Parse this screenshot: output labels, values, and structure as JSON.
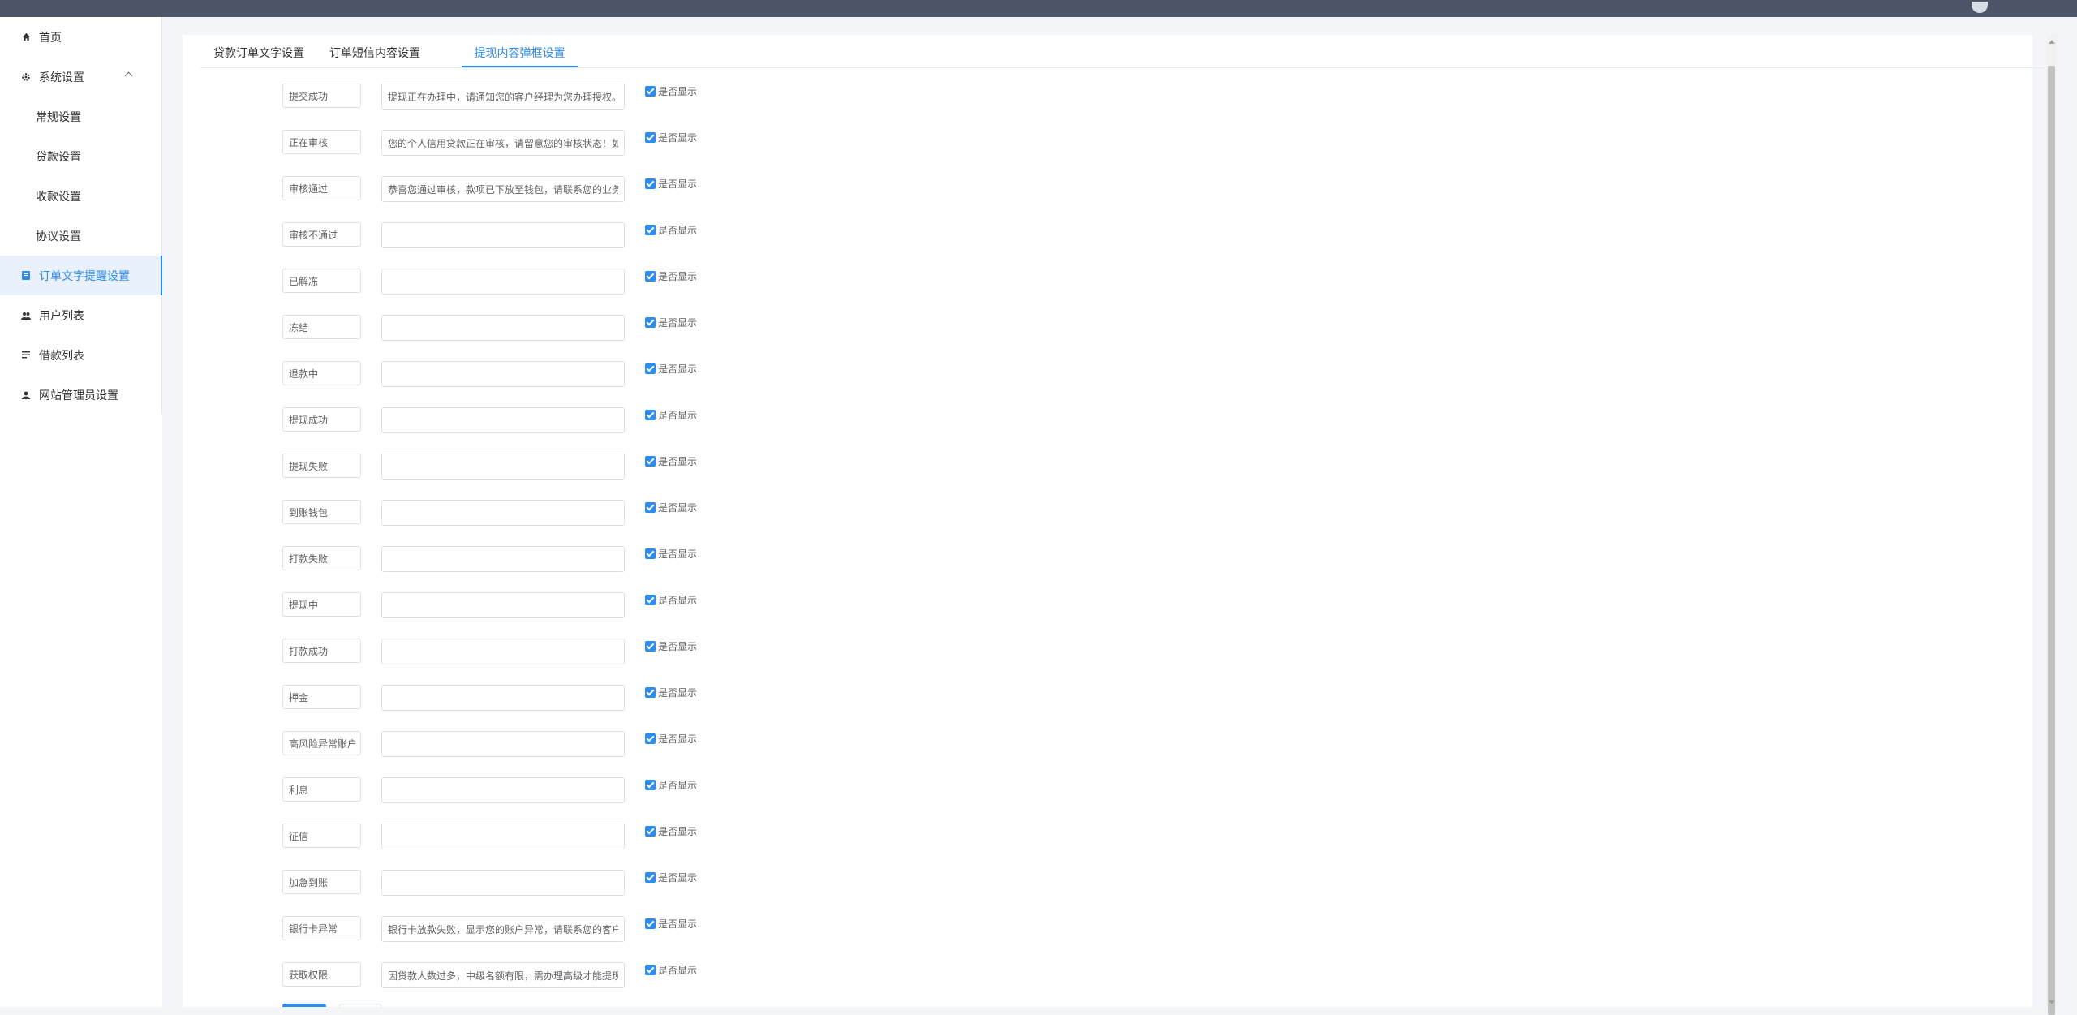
{
  "sidebar": {
    "items": [
      {
        "label": "首页",
        "icon": "home-icon"
      },
      {
        "label": "系统设置",
        "icon": "gear-icon"
      },
      {
        "label": "常规设置"
      },
      {
        "label": "贷款设置"
      },
      {
        "label": "收款设置"
      },
      {
        "label": "协议设置"
      },
      {
        "label": "订单文字提醒设置",
        "icon": "document-icon"
      },
      {
        "label": "用户列表",
        "icon": "users-icon"
      },
      {
        "label": "借款列表",
        "icon": "list-icon"
      },
      {
        "label": "网站管理员设置",
        "icon": "user-icon"
      }
    ]
  },
  "tabs": [
    {
      "label": "贷款订单文字设置"
    },
    {
      "label": "订单短信内容设置"
    },
    {
      "label": "提现内容弹框设置"
    }
  ],
  "show_label": "是否显示",
  "rows": [
    {
      "label": "提交成功",
      "value": "提现正在办理中，请通知您的客户经理为您办理授权。"
    },
    {
      "label": "正在审核",
      "value": "您的个人信用贷款正在审核，请留意您的审核状态！如"
    },
    {
      "label": "审核通过",
      "value": "恭喜您通过审核，款项已下放至钱包，请联系您的业务"
    },
    {
      "label": "审核不通过",
      "value": ""
    },
    {
      "label": "已解冻",
      "value": ""
    },
    {
      "label": "冻结",
      "value": ""
    },
    {
      "label": "退款中",
      "value": ""
    },
    {
      "label": "提现成功",
      "value": ""
    },
    {
      "label": "提现失败",
      "value": ""
    },
    {
      "label": "到账钱包",
      "value": ""
    },
    {
      "label": "打款失败",
      "value": ""
    },
    {
      "label": "提现中",
      "value": ""
    },
    {
      "label": "打款成功",
      "value": ""
    },
    {
      "label": "押金",
      "value": ""
    },
    {
      "label": "高风险异常账户",
      "value": ""
    },
    {
      "label": "利息",
      "value": ""
    },
    {
      "label": "征信",
      "value": ""
    },
    {
      "label": "加急到账",
      "value": ""
    },
    {
      "label": "银行卡异常",
      "value": "银行卡放款失败，显示您的账户异常，请联系您的客户"
    },
    {
      "label": "获取权限",
      "value": "因贷款人数过多，中级名额有限，需办理高级才能提现"
    }
  ],
  "colors": {
    "accent": "#2d8cf0",
    "topbar": "#4c5468"
  }
}
